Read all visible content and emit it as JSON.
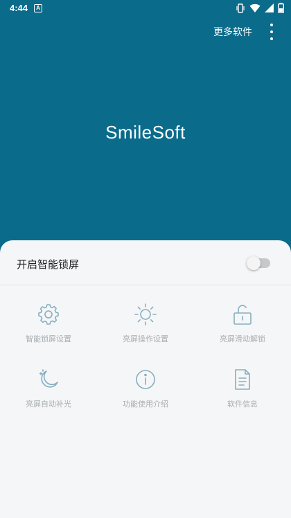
{
  "status_bar": {
    "time": "4:44",
    "notification_icon": "A",
    "icons": [
      "vibrate-icon",
      "wifi-icon",
      "signal-icon",
      "battery-icon"
    ]
  },
  "header": {
    "more_apps_label": "更多软件",
    "overflow_icon": "more-vert-icon"
  },
  "hero": {
    "title": "SmileSoft"
  },
  "sheet": {
    "toggle_label": "开启智能锁屏",
    "toggle_on": false,
    "tiles": [
      {
        "label": "智能锁屏设置",
        "icon": "gear-icon"
      },
      {
        "label": "亮屏操作设置",
        "icon": "sun-icon"
      },
      {
        "label": "亮屏滑动解锁",
        "icon": "unlock-icon"
      },
      {
        "label": "亮屏自动补光",
        "icon": "moon-icon"
      },
      {
        "label": "功能使用介绍",
        "icon": "info-icon"
      },
      {
        "label": "软件信息",
        "icon": "document-icon"
      }
    ]
  },
  "colors": {
    "primary": "#0b6b8a",
    "sheet_bg": "#f5f6f7",
    "icon": "#86aec0",
    "tile_text": "#a9aeb2"
  }
}
